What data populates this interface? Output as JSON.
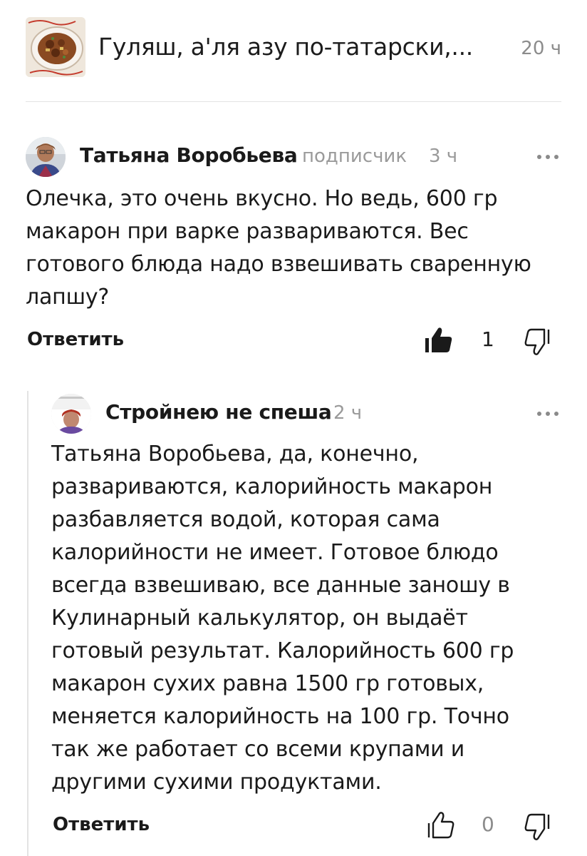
{
  "article": {
    "title": "Гуляш, а'ля азу по-татарски,...",
    "time": "20 ч",
    "thumbnail_icon": "food-dish-thumbnail"
  },
  "comments": [
    {
      "author": "Татьяна Воробьева",
      "role": "подписчик",
      "time": "3 ч",
      "text_lines": [
        "Олечка, это очень вкусно. Но ведь, 600 гр",
        "макарон при варке развариваются. Вес",
        "готового  блюда надо взвешивать сваренную",
        "лапшу?"
      ],
      "reply_label": "Ответить",
      "likes": "1",
      "liked": true
    },
    {
      "author": "Стройнею не спеша",
      "time": "2 ч",
      "text_lines": [
        "Татьяна Воробьева, да, конечно,",
        "развариваются, калорийность макарон",
        "разбавляется водой, которая сама",
        "калорийности не имеет. Готовое блюдо",
        "всегда взвешиваю, все данные заношу в",
        "Кулинарный калькулятор, он выдаёт",
        "готовый результат. Калорийность 600 гр",
        "макарон сухих равна 1500 гр готовых,",
        "меняется калорийность на 100 гр. Точно",
        "так же работает со всеми крупами и",
        "другими сухими продуктами."
      ],
      "reply_label": "Ответить",
      "likes": "0",
      "liked": false
    }
  ],
  "colors": {
    "text": "#1a1a1a",
    "muted": "#9a9a9a",
    "divider": "#e3e3e3"
  }
}
